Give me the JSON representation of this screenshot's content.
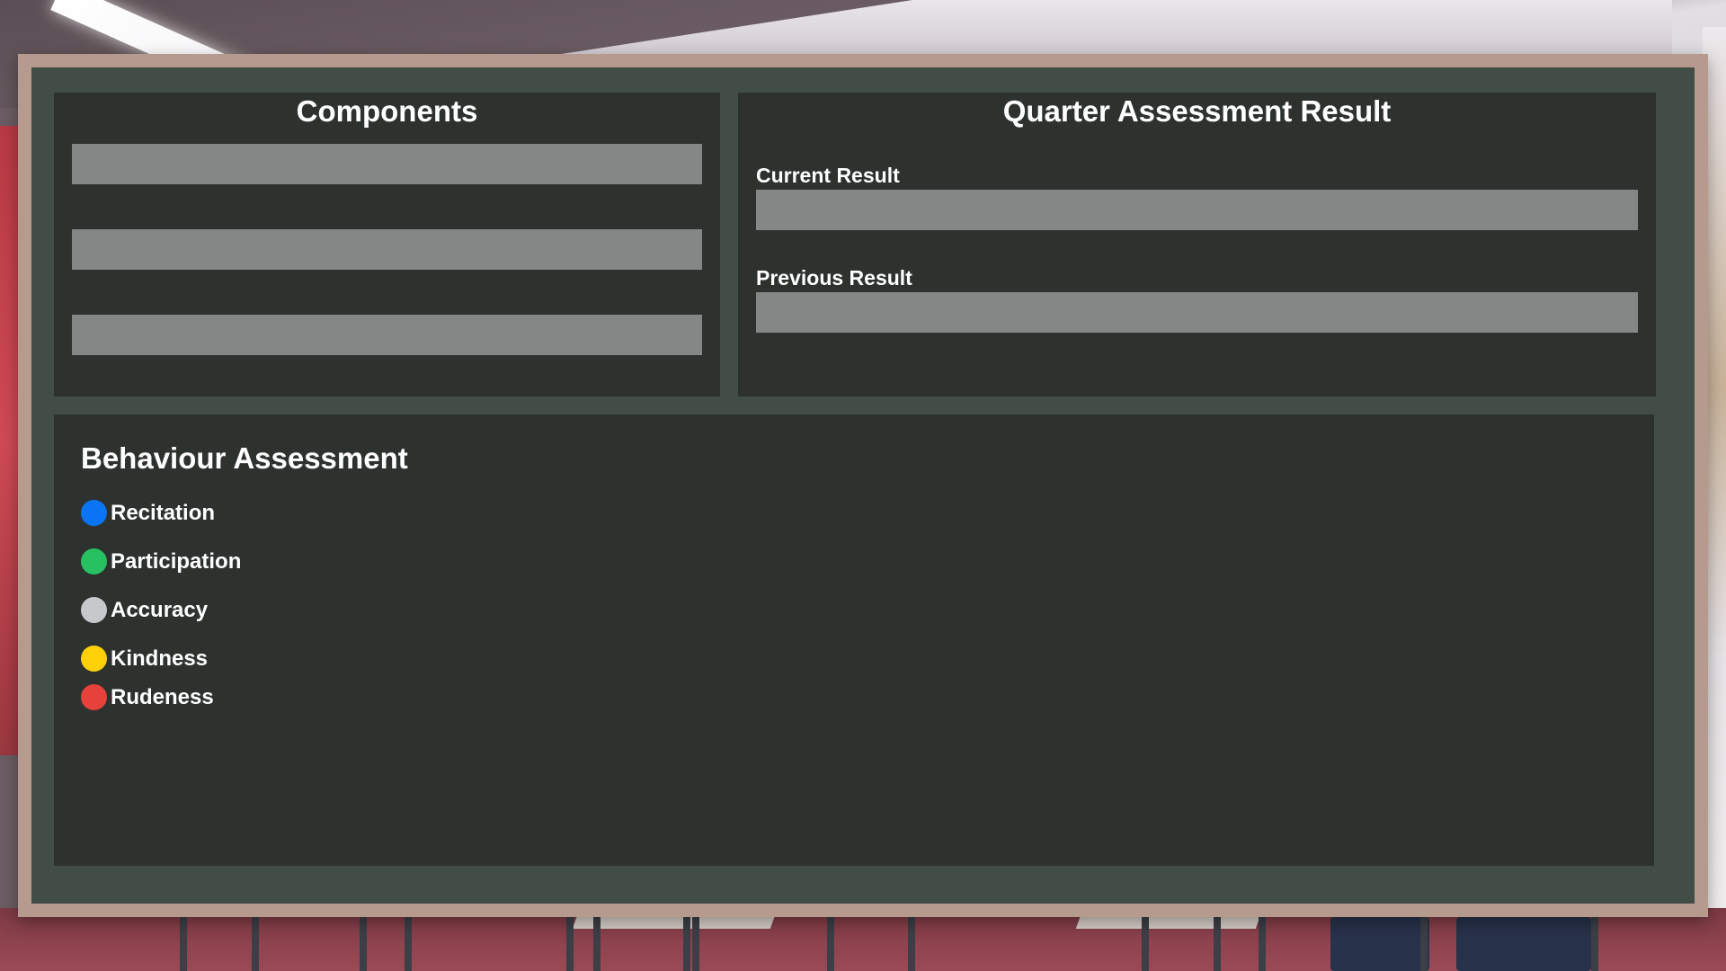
{
  "components": {
    "title": "Components",
    "rows": [
      "",
      "",
      ""
    ]
  },
  "quarter": {
    "title": "Quarter Assessment Result",
    "current_label": "Current Result",
    "current_value": "",
    "previous_label": "Previous Result",
    "previous_value": ""
  },
  "behaviour": {
    "title": "Behaviour Assessment",
    "legend": [
      {
        "label": "Recitation",
        "color": "#0a74f5",
        "icon": "blue-dot-icon"
      },
      {
        "label": "Participation",
        "color": "#27c162",
        "icon": "green-dot-icon"
      },
      {
        "label": "Accuracy",
        "color": "#c6c8cc",
        "icon": "gray-dot-icon"
      },
      {
        "label": "Kindness",
        "color": "#fed008",
        "icon": "yellow-dot-icon"
      },
      {
        "label": "Rudeness",
        "color": "#e6413a",
        "icon": "red-dot-icon"
      }
    ]
  },
  "colors": {
    "board": "#424d48",
    "panel": "#2d322f",
    "bar": "#858786",
    "frame": "#b59a8d"
  }
}
